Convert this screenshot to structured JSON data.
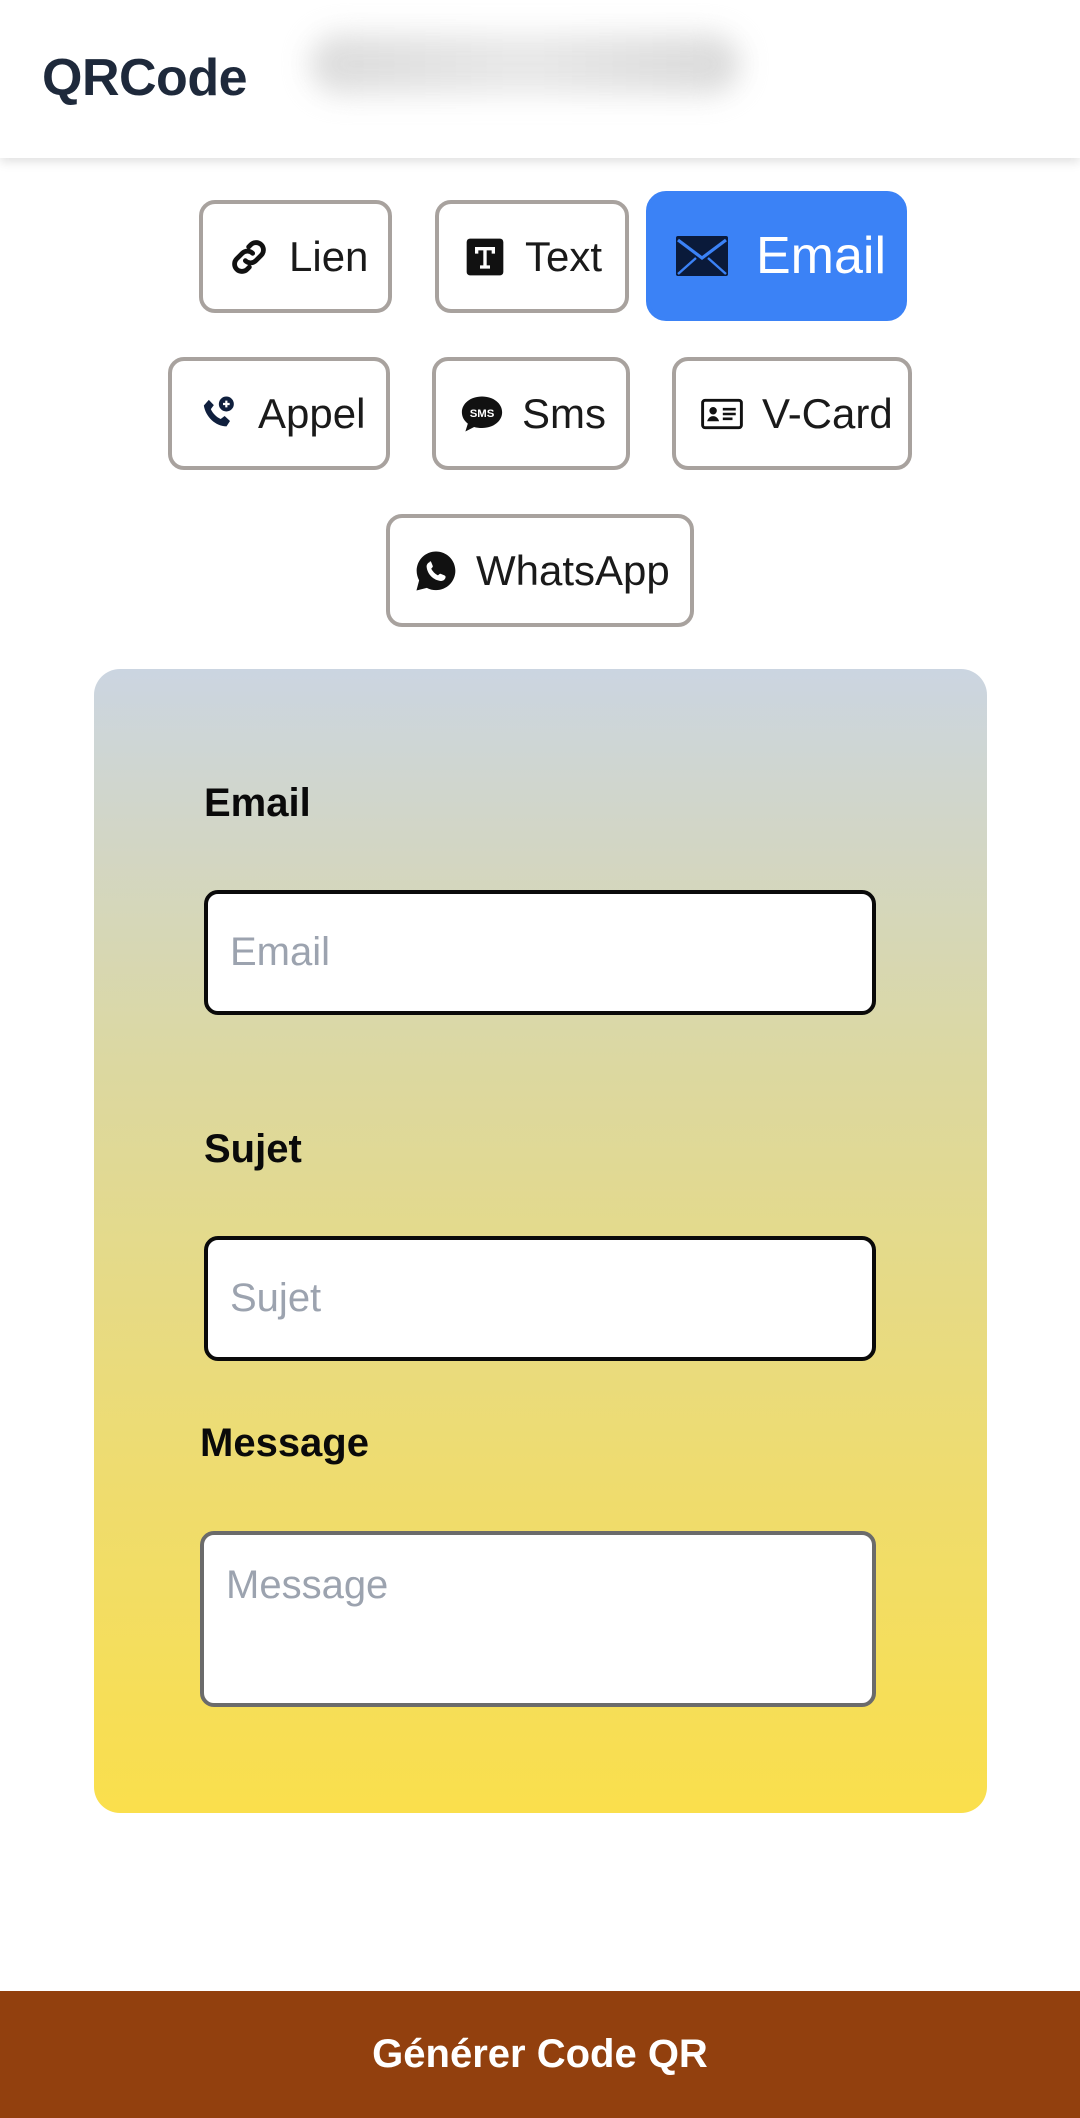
{
  "header": {
    "logo": "QRCode"
  },
  "types": {
    "lien": {
      "label": "Lien",
      "icon": "link-icon"
    },
    "text": {
      "label": "Text",
      "icon": "text-icon"
    },
    "email": {
      "label": "Email",
      "icon": "envelope-icon",
      "active": true
    },
    "appel": {
      "label": "Appel",
      "icon": "phone-icon"
    },
    "sms": {
      "label": "Sms",
      "icon": "sms-bubble-icon"
    },
    "vcard": {
      "label": "V-Card",
      "icon": "id-card-icon"
    },
    "whatsapp": {
      "label": "WhatsApp",
      "icon": "whatsapp-icon"
    }
  },
  "form": {
    "email": {
      "label": "Email",
      "placeholder": "Email",
      "value": ""
    },
    "sujet": {
      "label": "Sujet",
      "placeholder": "Sujet",
      "value": ""
    },
    "message": {
      "label": "Message",
      "placeholder": "Message",
      "value": ""
    }
  },
  "actions": {
    "generate_label": "Générer Code QR"
  },
  "colors": {
    "active_tab": "#3b82f6",
    "generate_bar": "#92400e",
    "card_gradient_top": "#cbd5e1",
    "card_gradient_bottom": "#fadf4c"
  }
}
